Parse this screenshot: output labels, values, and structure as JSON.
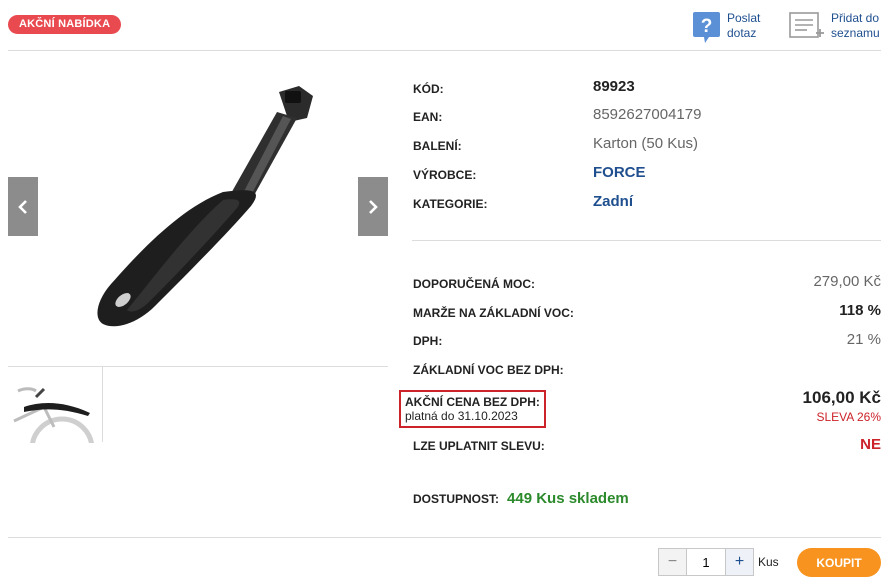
{
  "badge": "AKČNÍ NABÍDKA",
  "actions": {
    "ask": {
      "label": "Poslat\ndotaz",
      "icon": "question-icon"
    },
    "wishlist": {
      "label": "Přidat do\nseznamu",
      "icon": "list-add-icon"
    }
  },
  "gallery": {
    "prev_icon": "chevron-left-icon",
    "next_icon": "chevron-right-icon",
    "main_image": "rear-mudguard-image",
    "thumb_image": "mudguard-on-bike-thumbnail"
  },
  "specs": [
    {
      "label": "KÓD:",
      "value": "89923",
      "style": "bold"
    },
    {
      "label": "EAN:",
      "value": "8592627004179",
      "style": "plain"
    },
    {
      "label": "BALENÍ:",
      "value": "Karton (50 Kus)",
      "style": "plain"
    },
    {
      "label": "VÝROBCE:",
      "value": "FORCE",
      "style": "link"
    },
    {
      "label": "KATEGORIE:",
      "value": "Zadní",
      "style": "link"
    }
  ],
  "pricing": {
    "recommended_label": "DOPORUČENÁ MOC:",
    "recommended_value": "279,00 Kč",
    "margin_label": "MARŽE NA ZÁKLADNÍ VOC:",
    "margin_value": "118 %",
    "vat_label": "DPH:",
    "vat_value": "21 %",
    "base_label": "ZÁKLADNÍ VOC BEZ DPH:",
    "promo_label": "AKČNÍ CENA BEZ DPH:",
    "promo_valid": "platná do 31.10.2023",
    "promo_value": "106,00 Kč",
    "discount": "SLEVA 26%",
    "apply_discount_label": "LZE UPLATNIT SLEVU:",
    "apply_discount_value": "NE",
    "availability_label": "DOSTUPNOST:",
    "availability_value": "449 Kus skladem"
  },
  "cart": {
    "minus": "−",
    "qty": "1",
    "plus": "+",
    "unit": "Kus",
    "buy": "KOUPIT"
  },
  "colors": {
    "badge": "#e84a4f",
    "link": "#1f4f8f",
    "alert": "#cc2229",
    "stock": "#2c8a2c",
    "buy": "#f7931e"
  }
}
